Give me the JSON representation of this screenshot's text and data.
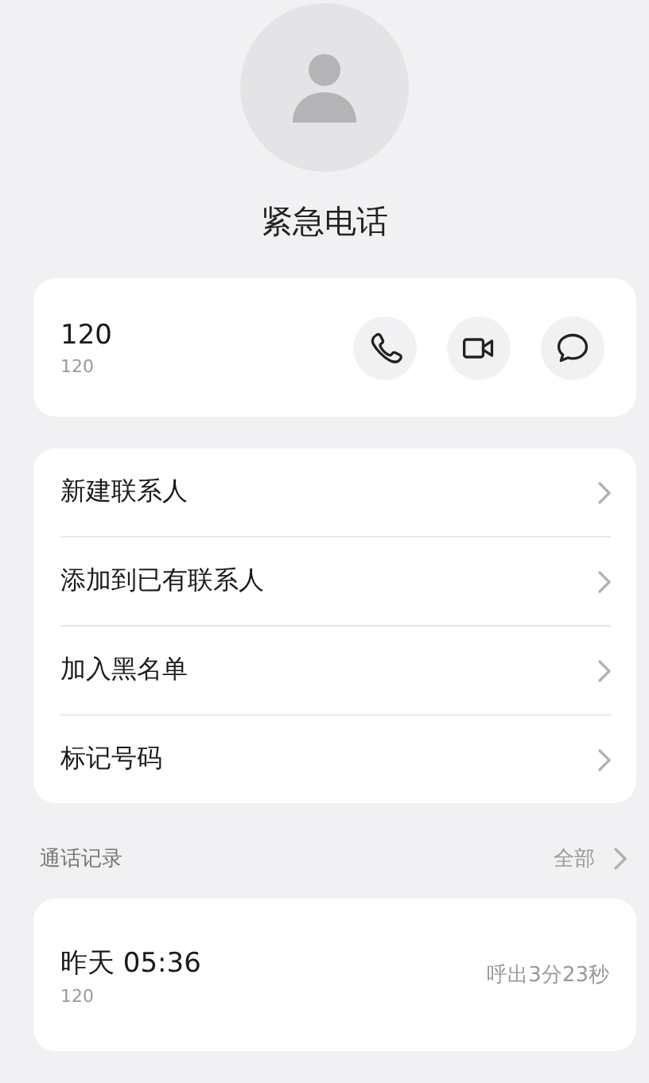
{
  "contact": {
    "name": "紧急电话"
  },
  "number_card": {
    "number": "120",
    "sub": "120",
    "actions": [
      {
        "kind": "call"
      },
      {
        "kind": "video"
      },
      {
        "kind": "message"
      }
    ]
  },
  "menu": [
    {
      "label": "新建联系人"
    },
    {
      "label": "添加到已有联系人"
    },
    {
      "label": "加入黑名单"
    },
    {
      "label": "标记号码"
    }
  ],
  "call_log": {
    "title": "通话记录",
    "all_link": "全部",
    "entries": [
      {
        "time": "昨天 05:36",
        "number": "120",
        "detail": "呼出3分23秒"
      }
    ]
  }
}
